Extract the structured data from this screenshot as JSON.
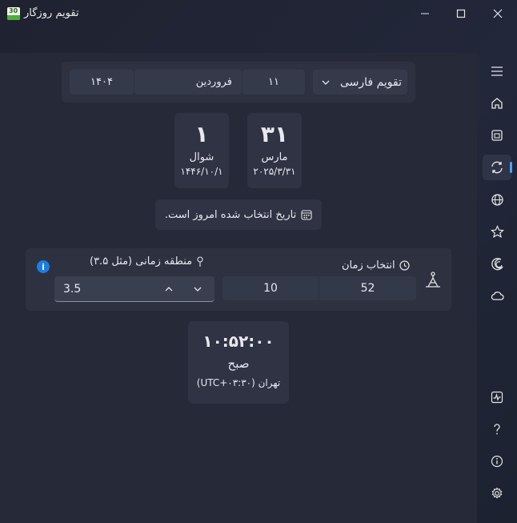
{
  "window": {
    "title": "تقویم روزگار",
    "icon_text": "30"
  },
  "converter": {
    "calendar_select": "تقویم فارسی",
    "day": "۱۱",
    "month": "فروردین",
    "year": "۱۴۰۴"
  },
  "results": {
    "gregorian": {
      "day": "۳۱",
      "month": "مارس",
      "date": "۲۰۲۵/۳/۳۱"
    },
    "hijri": {
      "day": "۱",
      "month": "شوال",
      "date": "۱۴۴۶/۱۰/۱"
    }
  },
  "today_note": "تاریخ انتخاب شده امروز است.",
  "time": {
    "label": "انتخاب زمان",
    "hour": "10",
    "minute": "52",
    "timezone_label": "منطقه زمانی (مثل ۳.۵)",
    "timezone_value": "3.5"
  },
  "clock": {
    "time": "۱۰:۵۲:۰۰",
    "period": "صبح",
    "zone": "تهران (UTC+۰۳:۳۰)"
  },
  "colors": {
    "accent": "#4aa3ff",
    "info": "#1a7ee6",
    "card": "#2d3140",
    "background": "#252938"
  },
  "nav": [
    "menu-icon",
    "home-icon",
    "calendar-icon",
    "convert-icon",
    "globe-icon",
    "star-icon",
    "moon-icon",
    "cloud-icon",
    "pulse-icon",
    "help-icon",
    "info-icon",
    "settings-icon"
  ]
}
